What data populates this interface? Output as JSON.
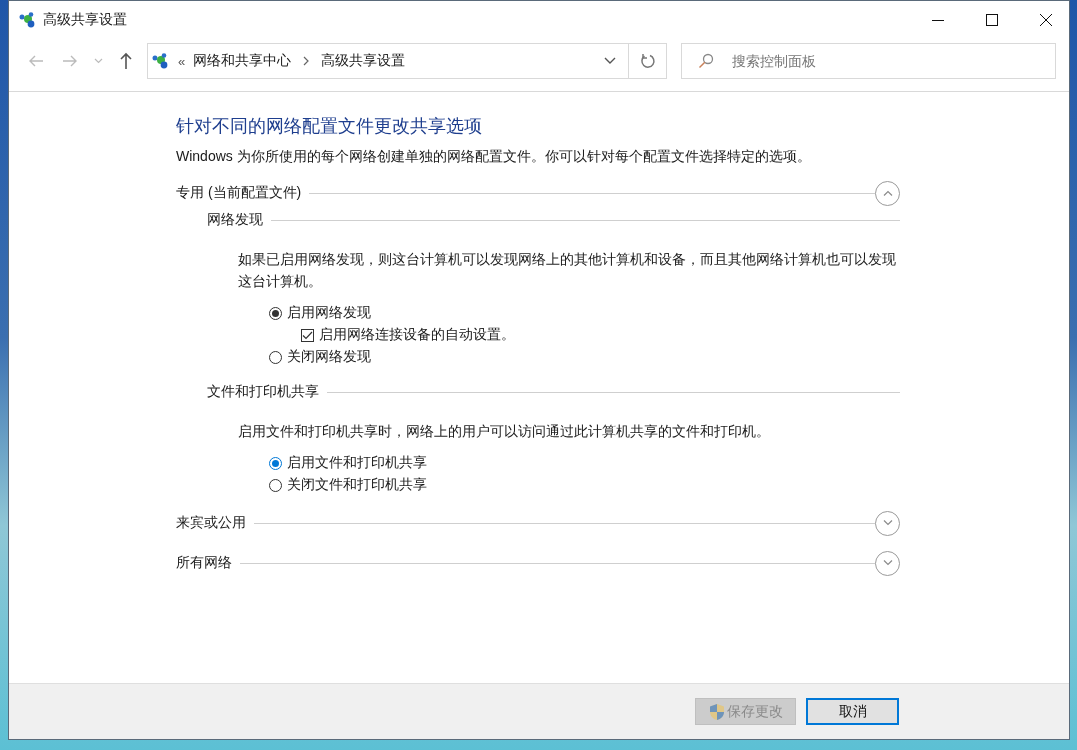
{
  "window": {
    "title": "高级共享设置"
  },
  "address_bar": {
    "overflow": "«",
    "breadcrumb": [
      "网络和共享中心",
      "高级共享设置"
    ]
  },
  "search": {
    "placeholder": "搜索控制面板"
  },
  "heading": "针对不同的网络配置文件更改共享选项",
  "description": "Windows 为你所使用的每个网络创建单独的网络配置文件。你可以针对每个配置文件选择特定的选项。",
  "profiles": [
    {
      "label": "专用 (当前配置文件)",
      "expanded": true,
      "groups": [
        {
          "title": "网络发现",
          "description": "如果已启用网络发现，则这台计算机可以发现网络上的其他计算机和设备，而且其他网络计算机也可以发现这台计算机。",
          "options": [
            {
              "kind": "radio",
              "label": "启用网络发现",
              "selected": true,
              "focused": false,
              "children": [
                {
                  "kind": "checkbox",
                  "label": "启用网络连接设备的自动设置。",
                  "checked": true
                }
              ]
            },
            {
              "kind": "radio",
              "label": "关闭网络发现",
              "selected": false,
              "focused": false
            }
          ]
        },
        {
          "title": "文件和打印机共享",
          "description": "启用文件和打印机共享时，网络上的用户可以访问通过此计算机共享的文件和打印机。",
          "options": [
            {
              "kind": "radio",
              "label": "启用文件和打印机共享",
              "selected": true,
              "focused": true
            },
            {
              "kind": "radio",
              "label": "关闭文件和打印机共享",
              "selected": false,
              "focused": false
            }
          ]
        }
      ]
    },
    {
      "label": "来宾或公用",
      "expanded": false
    },
    {
      "label": "所有网络",
      "expanded": false
    }
  ],
  "buttons": [
    {
      "label": "保存更改",
      "kind": "shield",
      "disabled": true,
      "focused": false
    },
    {
      "label": "取消",
      "kind": "plain",
      "disabled": false,
      "focused": true
    }
  ]
}
